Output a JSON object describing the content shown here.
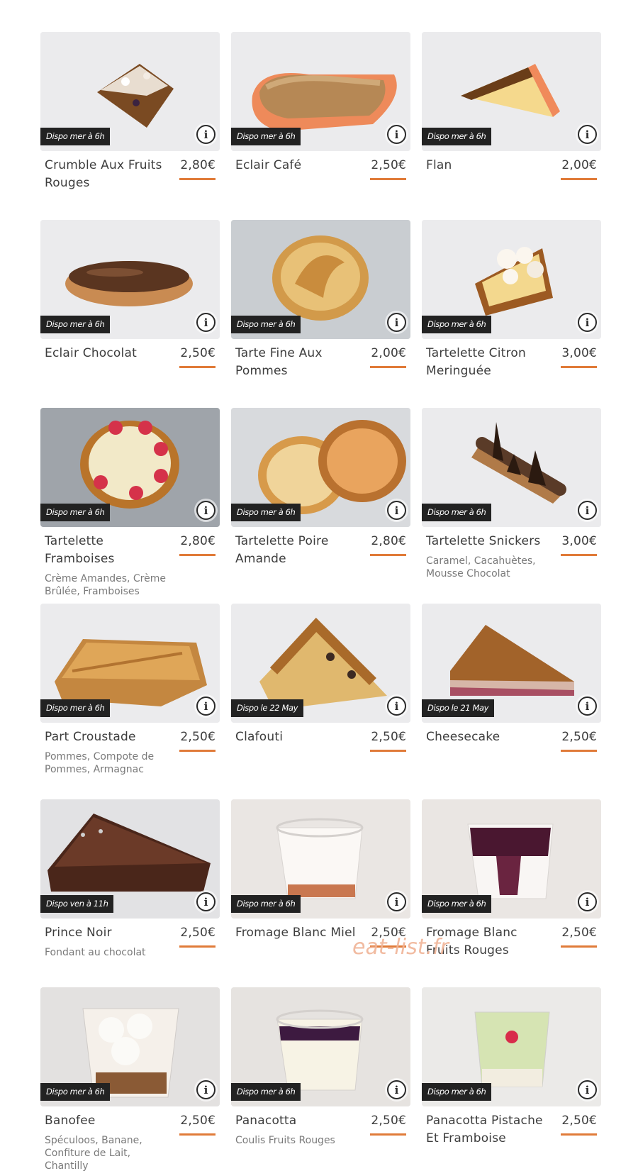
{
  "watermark": "eat-list.fr",
  "accent_color": "#e07b39",
  "info_icon_label": "i",
  "products": [
    {
      "name": "Crumble Aux Fruits Rouges",
      "price": "2,80€",
      "dispo": "Dispo mer à 6h",
      "desc": "",
      "image": "crumble"
    },
    {
      "name": "Eclair Café",
      "price": "2,50€",
      "dispo": "Dispo mer à 6h",
      "desc": "",
      "image": "eclair-cafe"
    },
    {
      "name": "Flan",
      "price": "2,00€",
      "dispo": "Dispo mer à 6h",
      "desc": "",
      "image": "flan"
    },
    {
      "name": "Eclair Chocolat",
      "price": "2,50€",
      "dispo": "Dispo mer à 6h",
      "desc": "",
      "image": "eclair-chocolat"
    },
    {
      "name": "Tarte Fine Aux Pommes",
      "price": "2,00€",
      "dispo": "Dispo mer à 6h",
      "desc": "",
      "image": "tarte-pommes"
    },
    {
      "name": "Tartelette Citron Meringuée",
      "price": "3,00€",
      "dispo": "Dispo mer à 6h",
      "desc": "",
      "image": "citron"
    },
    {
      "name": "Tartelette Framboises",
      "price": "2,80€",
      "dispo": "Dispo mer à 6h",
      "desc": "Crème Amandes, Crème Brûlée, Framboises",
      "image": "framboises"
    },
    {
      "name": "Tartelette Poire Amande",
      "price": "2,80€",
      "dispo": "Dispo mer à 6h",
      "desc": "",
      "image": "poire"
    },
    {
      "name": "Tartelette Snickers",
      "price": "3,00€",
      "dispo": "Dispo mer à 6h",
      "desc": "Caramel, Cacahuètes, Mousse Chocolat",
      "image": "snickers"
    },
    {
      "name": "Part Croustade",
      "price": "2,50€",
      "dispo": "Dispo mer à 6h",
      "desc": "Pommes, Compote de Pommes, Armagnac",
      "image": "croustade"
    },
    {
      "name": "Clafouti",
      "price": "2,50€",
      "dispo": "Dispo le 22 May",
      "desc": "",
      "image": "clafouti"
    },
    {
      "name": "Cheesecake",
      "price": "2,50€",
      "dispo": "Dispo le 21 May",
      "desc": "",
      "image": "cheesecake"
    },
    {
      "name": "Prince Noir",
      "price": "2,50€",
      "dispo": "Dispo ven à 11h",
      "desc": "Fondant au chocolat",
      "image": "prince-noir"
    },
    {
      "name": "Fromage Blanc Miel",
      "price": "2,50€",
      "dispo": "Dispo mer à 6h",
      "desc": "",
      "image": "fromage-miel"
    },
    {
      "name": "Fromage Blanc Fruits Rouges",
      "price": "2,50€",
      "dispo": "Dispo mer à 6h",
      "desc": "",
      "image": "fromage-fruits"
    },
    {
      "name": "Banofee",
      "price": "2,50€",
      "dispo": "Dispo mer à 6h",
      "desc": "Spéculoos, Banane, Confiture de Lait, Chantilly",
      "image": "banofee"
    },
    {
      "name": "Panacotta",
      "price": "2,50€",
      "dispo": "Dispo mer à 6h",
      "desc": "Coulis Fruits Rouges",
      "image": "panacotta"
    },
    {
      "name": "Panacotta Pistache Et Framboise",
      "price": "2,50€",
      "dispo": "Dispo mer à 6h",
      "desc": "",
      "image": "panacotta-pistache"
    }
  ]
}
